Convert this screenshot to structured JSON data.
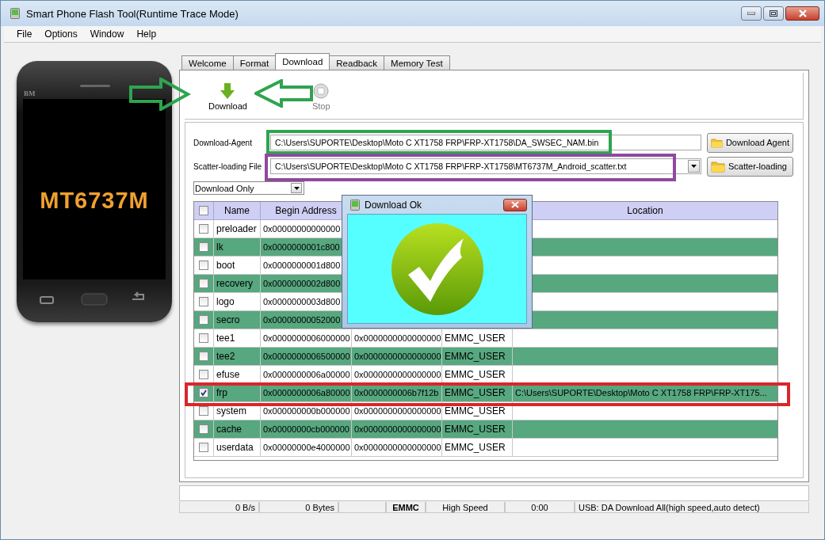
{
  "window": {
    "title": "Smart Phone Flash Tool(Runtime Trace Mode)"
  },
  "menu": [
    {
      "label": "File"
    },
    {
      "label": "Options"
    },
    {
      "label": "Window"
    },
    {
      "label": "Help"
    }
  ],
  "phone": {
    "brand": "BM",
    "chip": "MT6737M"
  },
  "tabs": [
    {
      "label": "Welcome",
      "selected": false
    },
    {
      "label": "Format",
      "selected": false
    },
    {
      "label": "Download",
      "selected": true
    },
    {
      "label": "Readback",
      "selected": false
    },
    {
      "label": "Memory Test",
      "selected": false
    }
  ],
  "toolbar": [
    {
      "kind": "download",
      "label": "Download",
      "disabled": false
    },
    {
      "kind": "stop",
      "label": "Stop",
      "disabled": true
    }
  ],
  "download_agent": {
    "label": "Download-Agent",
    "value": "C:\\Users\\SUPORTE\\Desktop\\Moto C XT1758 FRP\\FRP-XT1758\\DA_SWSEC_NAM.bin",
    "button": "Download Agent"
  },
  "scatter": {
    "label": "Scatter-loading File",
    "value": "C:\\Users\\SUPORTE\\Desktop\\Moto C XT1758 FRP\\FRP-XT1758\\MT6737M_Android_scatter.txt",
    "button": "Scatter-loading"
  },
  "mode": {
    "value": "Download Only"
  },
  "table": {
    "all_checked": false,
    "columns": [
      "Name",
      "Begin Address",
      "Location"
    ],
    "rows": [
      {
        "checked": false,
        "name": "preloader",
        "begin_address": "0x00000000000000"
      },
      {
        "checked": false,
        "name": "lk",
        "begin_address": "0x0000000001c800"
      },
      {
        "checked": false,
        "name": "boot",
        "begin_address": "0x0000000001d800"
      },
      {
        "checked": false,
        "name": "recovery",
        "begin_address": "0x0000000002d800"
      },
      {
        "checked": false,
        "name": "logo",
        "begin_address": "0x0000000003d800"
      },
      {
        "checked": false,
        "name": "secro",
        "begin_address": "0x00000000052000"
      },
      {
        "checked": false,
        "name": "tee1",
        "begin_address": "0x0000000006000000",
        "column_4": "0x0000000000000000",
        "column_5": "EMMC_USER"
      },
      {
        "checked": false,
        "name": "tee2",
        "begin_address": "0x0000000006500000",
        "column_4": "0x0000000000000000",
        "column_5": "EMMC_USER"
      },
      {
        "checked": false,
        "name": "efuse",
        "begin_address": "0x0000000006a00000",
        "column_4": "0x0000000000000000",
        "column_5": "EMMC_USER"
      },
      {
        "checked": true,
        "name": "frp",
        "begin_address": "0x0000000006a80000",
        "column_4": "0x0000000006b7f12b",
        "column_5": "EMMC_USER",
        "location": "C:\\Users\\SUPORTE\\Desktop\\Moto C XT1758 FRP\\FRP-XT175..."
      },
      {
        "checked": false,
        "name": "system",
        "begin_address": "0x000000000b000000",
        "column_4": "0x0000000000000000",
        "column_5": "EMMC_USER"
      },
      {
        "checked": false,
        "name": "cache",
        "begin_address": "0x00000000cb000000",
        "column_4": "0x0000000000000000",
        "column_5": "EMMC_USER"
      },
      {
        "checked": false,
        "name": "userdata",
        "begin_address": "0x00000000e4000000",
        "column_4": "0x0000000000000000",
        "column_5": "EMMC_USER"
      }
    ]
  },
  "dialog": {
    "title": "Download Ok"
  },
  "progress": {
    "level": 0
  },
  "status_bar": [
    {
      "text": "0 B/s"
    },
    {
      "text": "0 Bytes"
    },
    {
      "kind": "blank"
    },
    {
      "text": "EMMC",
      "bold": true
    },
    {
      "text": "High Speed"
    },
    {
      "text": "0:00"
    },
    {
      "text": "USB: DA Download All(high speed,auto detect)"
    }
  ],
  "annotations": [
    {
      "kind": "arrow_right",
      "color": "#2ea44f"
    },
    {
      "kind": "arrow_left",
      "color": "#2ea44f"
    },
    {
      "kind": "frame",
      "color": "#2ea44f"
    },
    {
      "kind": "frame",
      "color": "#8e4a9e"
    },
    {
      "kind": "frame",
      "color": "#d9262b"
    }
  ]
}
